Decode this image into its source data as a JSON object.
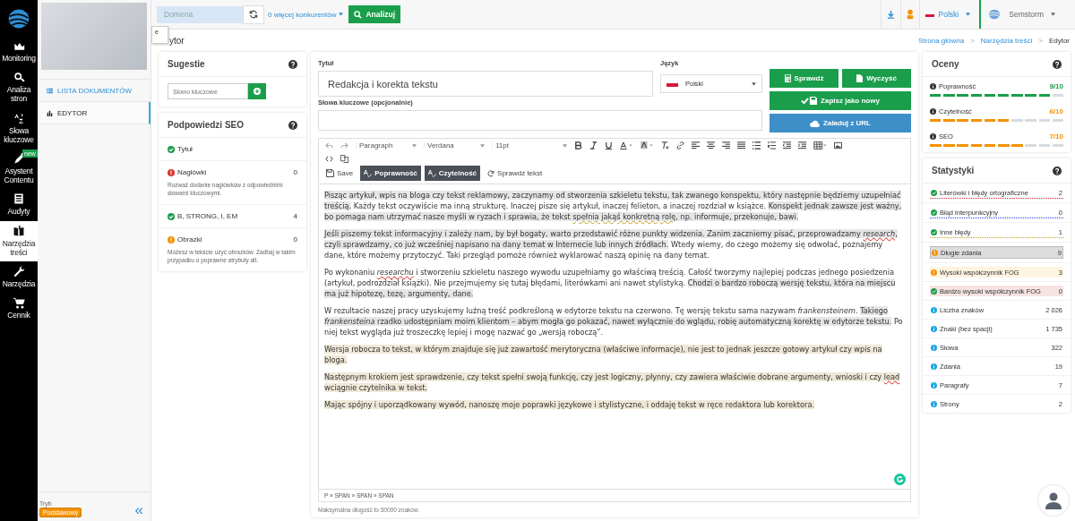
{
  "nav": {
    "items": [
      {
        "label": "Monitoring",
        "selected": false
      },
      {
        "label": "Analiza stron",
        "selected": false
      },
      {
        "label": "Słowa kluczowe",
        "selected": false
      },
      {
        "label": "Asystent Contentu",
        "selected": false,
        "badge": "new"
      },
      {
        "label": "Audyty",
        "selected": false
      },
      {
        "label": "Narzędzia treści",
        "selected": true
      },
      {
        "label": "Narzędzia",
        "selected": false
      },
      {
        "label": "Cennik",
        "selected": false
      }
    ]
  },
  "submenu": {
    "items": [
      {
        "label": "LISTA DOKUMENTÓW",
        "selected": false
      },
      {
        "label": "EDYTOR",
        "selected": true
      }
    ],
    "mode_label": "Tryb",
    "mode_badge": "Podstawowy",
    "collapse": "«"
  },
  "topbar": {
    "domain_placeholder": "Domena",
    "competitors": "0 więcej konkurentów",
    "analyze": "Analizuj",
    "language": "Polski",
    "account": "Semstorm"
  },
  "popover_fragment": "e",
  "page_title": "ytor",
  "breadcrumb": {
    "separator": ">",
    "items": [
      "Strona główna",
      "Narzędzia treści",
      "Edytor"
    ]
  },
  "suggestions": {
    "title": "Sugestie",
    "placeholder": "Słowo kluczowe"
  },
  "seo_hints": {
    "title": "Podpowiedzi SEO",
    "items": [
      {
        "kind": "ok",
        "label": "Tytuł"
      },
      {
        "kind": "error",
        "label": "Nagłówki",
        "count": "0",
        "description": "Rozważ dodanie nagłówków z odpowiednimi słowami kluczowymi."
      },
      {
        "kind": "ok",
        "label": "B, STRONG, I, EM",
        "count": "4"
      },
      {
        "kind": "warning",
        "label": "Obrazki",
        "count": "0",
        "description": "Możesz w tekście użyć obrazków. Zadbaj w takim przypadku o poprawne atrybuty alt."
      }
    ]
  },
  "form": {
    "title_label": "Tytuł",
    "title_value": "Redakcja i korekta tekstu",
    "language_label": "Język",
    "language_value": "Polski",
    "keywords_label": "Słowa kluczowe (opcjonalnie)"
  },
  "actions": {
    "check": "Sprawdź",
    "clear": "Wyczyść",
    "save_new": "Zapisz jako nowy",
    "load_url": "Załaduj z URL"
  },
  "editor": {
    "format": "Paragraph",
    "font": "Verdana",
    "size": "11pt",
    "save": "Save",
    "toggles": [
      {
        "label": "Poprawność",
        "selected": true
      },
      {
        "label": "Czytelność",
        "selected": true
      }
    ],
    "check_text": "Sprawdź tekst",
    "paragraphs": [
      [
        {
          "text": "Pisząc artykuł, wpis na bloga czy tekst reklamowy, zaczynamy od stworzenia szkieletu tekstu, tak zwanego konspektu, który następnie będziemy uzupełniać treścią.",
          "kind": "long",
          "misspelled": false,
          "flagged": false
        },
        {
          "text": " Każdy tekst oczywiście ma inną strukturę. Inaczej pisze się artykuł, inaczej felieton, a inaczej rozdział w książce. ",
          "kind": "plain",
          "misspelled": false,
          "flagged": false
        },
        {
          "text": "Konspekt jednak zawsze jest ważny, bo pomaga nam utrzymać nasze myśli w ryzach i sprawia, że tekst ",
          "kind": "long",
          "misspelled": false,
          "flagged": false
        },
        {
          "text": "spełnia jakąś konkretną rolę",
          "kind": "long",
          "misspelled": false,
          "flagged": true
        },
        {
          "text": ", np. informuje, przekonuje, bawi.",
          "kind": "long",
          "misspelled": false,
          "flagged": false
        }
      ],
      [
        {
          "text": "Jeśli piszemy tekst informacyjny i zależy nam, by był bogaty, warto przedstawić różne punkty widzenia.",
          "kind": "long",
          "misspelled": false,
          "flagged": false
        },
        {
          "text": " Zanim zaczniemy pisać, przeprowadzamy ",
          "kind": "long",
          "misspelled": false,
          "flagged": false
        },
        {
          "text": "*research*",
          "kind": "long",
          "misspelled": true,
          "flagged": false
        },
        {
          "text": ", czyli sprawdzamy, co już wcześniej napisano na dany temat w Internecie lub innych źródłach.",
          "kind": "long",
          "misspelled": false,
          "flagged": false
        },
        {
          "text": " Wtedy wiemy, do czego możemy się odwołać, poznajemy dane, które możemy przytoczyć. Taki przegląd pomoże również wyklarować naszą opinię na dany temat.",
          "kind": "plain",
          "misspelled": false,
          "flagged": false
        }
      ],
      [
        {
          "text": "Po wykonaniu ",
          "kind": "plain",
          "misspelled": false,
          "flagged": false
        },
        {
          "text": "*researchu*",
          "kind": "plain",
          "misspelled": true,
          "flagged": false
        },
        {
          "text": " i stworzeniu szkieletu naszego wywodu uzupełniamy go właściwą treścią. Całość tworzymy najlepiej podczas jednego posiedzenia (artykuł, podrozdział książki). Nie przejmujemy się tutaj błędami, literówkami ani nawet stylistyką. ",
          "kind": "plain",
          "misspelled": false,
          "flagged": false
        },
        {
          "text": "Chodzi o bardzo roboczą wersję tekstu, która na miejscu ma już hipotezę, tezę, argumenty, dane.",
          "kind": "long",
          "misspelled": false,
          "flagged": false
        }
      ],
      [
        {
          "text": "W rezultacie naszej pracy uzyskujemy luźną treść podkreśloną w edytorze tekstu na czerwono. Tę wersję tekstu sama nazywam *frankensteinem*. ",
          "kind": "plain",
          "misspelled": false,
          "flagged": false
        },
        {
          "text": "Takiego *frankensteina* rzadko udostępniam moim klientom – abym mogła go pokazać, nawet wyłącznie do wglądu, robię automatyczną korektę w edytorze tekstu.",
          "kind": "long",
          "misspelled": false,
          "flagged": false
        },
        {
          "text": " Po niej tekst wygląda już troszeczkę lepiej i mogę nazwać go „wersją roboczą”.",
          "kind": "plain",
          "misspelled": false,
          "flagged": false
        }
      ],
      [
        {
          "text": "Wersja robocza to tekst, w którym znajduje się już zawartość merytoryczna (właściwe informacje), nie jest to jednak jeszcze gotowy artykuł czy wpis na bloga.",
          "kind": "fog",
          "misspelled": false,
          "flagged": false
        }
      ],
      [
        {
          "text": "Następnym krokiem jest sprawdzenie, czy tekst spełni swoją funkcję, czy jest logiczny, płynny, czy zawiera właściwie dobrane argumenty, wnioski i czy ",
          "kind": "fog",
          "misspelled": false,
          "flagged": false
        },
        {
          "text": "lead",
          "kind": "fog",
          "misspelled": true,
          "flagged": false
        },
        {
          "text": " wciągnie czytelnika w tekst.",
          "kind": "fog",
          "misspelled": false,
          "flagged": false
        }
      ],
      [
        {
          "text": "Mając spójny i uporządkowany wywód, nanoszę moje poprawki językowe i stylistyczne, i oddaję tekst w ręce redaktora lub korektora.",
          "kind": "fog",
          "misspelled": false,
          "flagged": false
        }
      ]
    ],
    "path": "P » SPAN » SPAN » SPAN",
    "max_note": "Maksymalna długość to *50000* znaków."
  },
  "ratings": {
    "title": "Oceny",
    "items": [
      {
        "label": "Poprawność",
        "score": "9/10",
        "level": 0.9,
        "color": "#1a9e4b"
      },
      {
        "label": "Czytelność",
        "score": "6/10",
        "level": 0.6,
        "color": "#f39200"
      },
      {
        "label": "SEO",
        "score": "7/10",
        "level": 0.7,
        "color": "#f39200"
      }
    ]
  },
  "stats": {
    "title": "Statystyki",
    "items": [
      {
        "kind": "spelling",
        "color": "#1a9e4b",
        "label": "Literówki i błędy ortograficzne",
        "value": "2"
      },
      {
        "kind": "punctuation",
        "color": "#1a9e4b",
        "label": "Błąd interpunkcyjny",
        "value": "0"
      },
      {
        "kind": "other",
        "color": "#1a9e4b",
        "label": "Inne błędy",
        "value": "1"
      },
      {
        "kind": "long",
        "color": "#f39200",
        "label": "Długie zdania",
        "value": "9"
      },
      {
        "kind": "fog",
        "color": "#f39200",
        "label": "Wysoki współczynnik FOG",
        "value": "3"
      },
      {
        "kind": "veryfog",
        "color": "#1a9e4b",
        "label": "Bardzo wysoki współczynnik FOG",
        "value": "0"
      },
      {
        "kind": "info",
        "color": "#1ba7e0",
        "label": "Liczba znaków",
        "value": "2 026"
      },
      {
        "kind": "info",
        "color": "#1ba7e0",
        "label": "Znaki (bez spacji)",
        "value": "1 735"
      },
      {
        "kind": "info",
        "color": "#1ba7e0",
        "label": "Słowa",
        "value": "322"
      },
      {
        "kind": "info",
        "color": "#1ba7e0",
        "label": "Zdania",
        "value": "19"
      },
      {
        "kind": "info",
        "color": "#1ba7e0",
        "label": "Paragrafy",
        "value": "7"
      },
      {
        "kind": "info",
        "color": "#1ba7e0",
        "label": "Strony",
        "value": "2"
      }
    ]
  }
}
